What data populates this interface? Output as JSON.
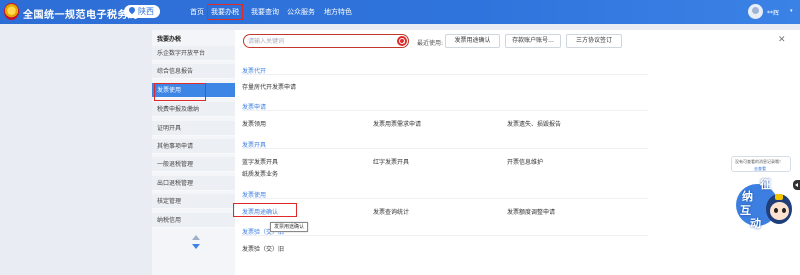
{
  "header": {
    "site_title": "全国统一规范电子税务局",
    "region": "陕西",
    "nav": [
      "首页",
      "我要办税",
      "我要查询",
      "公众服务",
      "地方特色"
    ],
    "active_nav": "我要办税",
    "user_name": "**辉"
  },
  "sidebar": {
    "title": "我要办税",
    "items": [
      "乐企数字开放平台",
      "综合信息报告",
      "发票使用",
      "税费申报及缴纳",
      "证明开具",
      "其他事项申请",
      "一般退税管理",
      "出口退税管理",
      "核定管理",
      "纳税信用"
    ],
    "active_item": "发票使用"
  },
  "search": {
    "placeholder": "请输入关键词",
    "recent_label": "最近使用:",
    "recent": [
      "发票用途确认",
      "存款账户账号...",
      "三方协议签订"
    ]
  },
  "sections": [
    {
      "title": "发票代开",
      "items": [
        "存量房代开发票申请"
      ]
    },
    {
      "title": "发票申请",
      "items": [
        "发票领用",
        "发票用票需求申请",
        "发票遗失、损毁报告"
      ]
    },
    {
      "title": "发票开具",
      "items": [
        "蓝字发票开具",
        "红字发票开具",
        "开票信息维护",
        "纸质发票业务"
      ]
    },
    {
      "title": "发票使用",
      "items": [
        "发票用途确认",
        "发票查询统计",
        "发票额度调整申请"
      ]
    },
    {
      "title": "发票验（交）旧",
      "items": [
        "发票验（交）旧"
      ]
    }
  ],
  "tooltip": "发票用途确认",
  "helper": {
    "line1": "没有可查看的消息记录哦！",
    "line2": "去查看",
    "mascot_chars": [
      "征",
      "纳",
      "互",
      "动"
    ]
  },
  "colors": {
    "primary": "#2f74dc",
    "active_side": "#3d86e6",
    "link": "#3d7fe0",
    "highlight": "#e02a2a"
  }
}
